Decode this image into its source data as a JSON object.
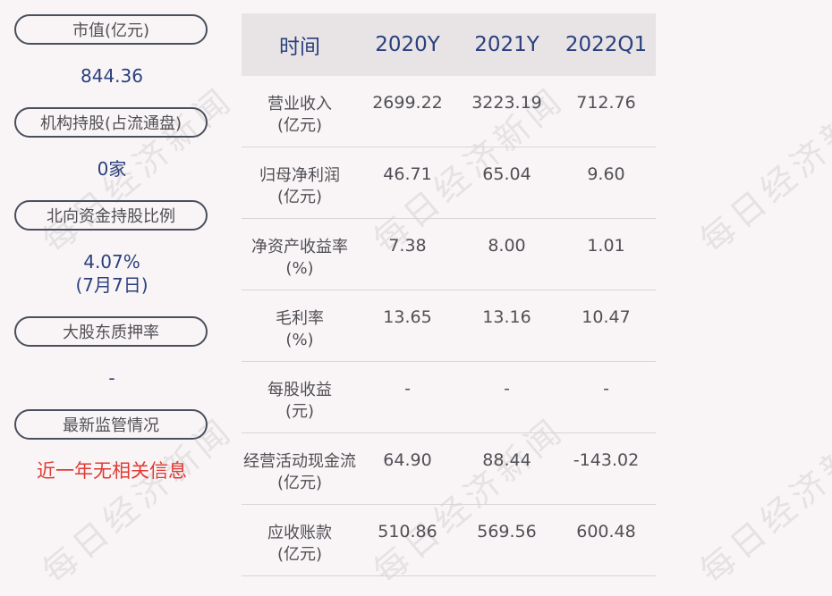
{
  "left": {
    "items": [
      {
        "label": "市值(亿元)",
        "value": "844.36"
      },
      {
        "label": "机构持股(占流通盘)",
        "value": "0家"
      },
      {
        "label": "北向资金持股比例",
        "value": "4.07%",
        "value2": "(7月7日)"
      },
      {
        "label": "大股东质押率",
        "value": "-"
      },
      {
        "label": "最新监管情况",
        "value": "近一年无相关信息"
      }
    ]
  },
  "table": {
    "headers": [
      "时间",
      "2020Y",
      "2021Y",
      "2022Q1"
    ],
    "rows": [
      {
        "label": "营业收入",
        "unit": "(亿元)",
        "values": [
          "2699.22",
          "3223.19",
          "712.76"
        ]
      },
      {
        "label": "归母净利润",
        "unit": "(亿元)",
        "values": [
          "46.71",
          "65.04",
          "9.60"
        ]
      },
      {
        "label": "净资产收益率",
        "unit": "(%)",
        "values": [
          "7.38",
          "8.00",
          "1.01"
        ]
      },
      {
        "label": "毛利率",
        "unit": "(%)",
        "values": [
          "13.65",
          "13.16",
          "10.47"
        ]
      },
      {
        "label": "每股收益",
        "unit": "(元)",
        "values": [
          "-",
          "-",
          "-"
        ]
      },
      {
        "label": "经营活动现金流",
        "unit": "(亿元)",
        "values": [
          "64.90",
          "88.44",
          "-143.02"
        ]
      },
      {
        "label": "应收账款",
        "unit": "(亿元)",
        "values": [
          "510.86",
          "569.56",
          "600.48"
        ]
      }
    ]
  },
  "watermark": "每日经济新闻"
}
